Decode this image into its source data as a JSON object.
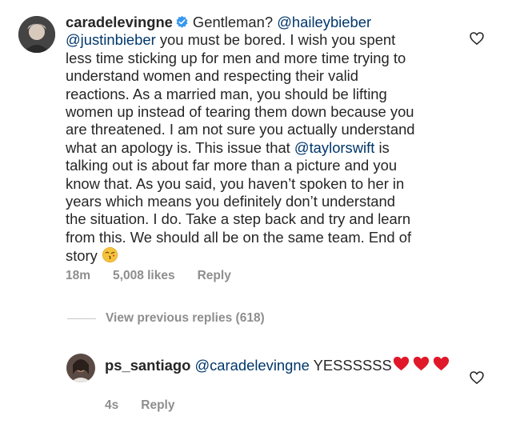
{
  "comment": {
    "username": "caradelevingne",
    "segments": [
      {
        "t": "text",
        "v": "Gentleman? "
      },
      {
        "t": "mention",
        "v": "@haileybieber"
      },
      {
        "t": "br"
      },
      {
        "t": "mention",
        "v": "@justinbieber"
      },
      {
        "t": "text",
        "v": " you must be bored. I wish you spent"
      },
      {
        "t": "br"
      },
      {
        "t": "text",
        "v": "less time sticking up for men and more time trying to"
      },
      {
        "t": "br"
      },
      {
        "t": "text",
        "v": "understand women and respecting their valid"
      },
      {
        "t": "br"
      },
      {
        "t": "text",
        "v": "reactions. As a married man, you should be lifting"
      },
      {
        "t": "br"
      },
      {
        "t": "text",
        "v": "women up instead of tearing them down because you"
      },
      {
        "t": "br"
      },
      {
        "t": "text",
        "v": "are threatened. I am not sure you actually understand"
      },
      {
        "t": "br"
      },
      {
        "t": "text",
        "v": "what an apology is. This issue that "
      },
      {
        "t": "mention",
        "v": "@taylorswift"
      },
      {
        "t": "text",
        "v": " is"
      },
      {
        "t": "br"
      },
      {
        "t": "text",
        "v": "talking out is about far more than a picture and you"
      },
      {
        "t": "br"
      },
      {
        "t": "text",
        "v": "know that. As you said, you haven’t spoken to her in"
      },
      {
        "t": "br"
      },
      {
        "t": "text",
        "v": "years which means you definitely don’t understand"
      },
      {
        "t": "br"
      },
      {
        "t": "text",
        "v": "the situation. I do. Take a step back and try and learn"
      },
      {
        "t": "br"
      },
      {
        "t": "text",
        "v": "from this. We should all be on the same team. End of"
      },
      {
        "t": "br"
      },
      {
        "t": "text",
        "v": "story "
      },
      {
        "t": "emoji",
        "v": "kiss-emoji"
      }
    ],
    "time": "18m",
    "likes": "5,008 likes",
    "reply_label": "Reply"
  },
  "view_replies": "View previous replies (618)",
  "reply": {
    "username": "ps_santiago",
    "mention": "@caradelevingne",
    "text": " YESSSSSS",
    "emojis": [
      "red-heart-emoji",
      "red-heart-emoji",
      "red-heart-emoji"
    ],
    "time": "4s",
    "reply_label": "Reply"
  },
  "colors": {
    "text": "#262626",
    "mention": "#00376b",
    "meta": "#8e8e8e",
    "verified": "#3897f0",
    "heart": "#e0182a"
  },
  "icons": [
    "verified-badge-icon",
    "like-heart-icon"
  ]
}
